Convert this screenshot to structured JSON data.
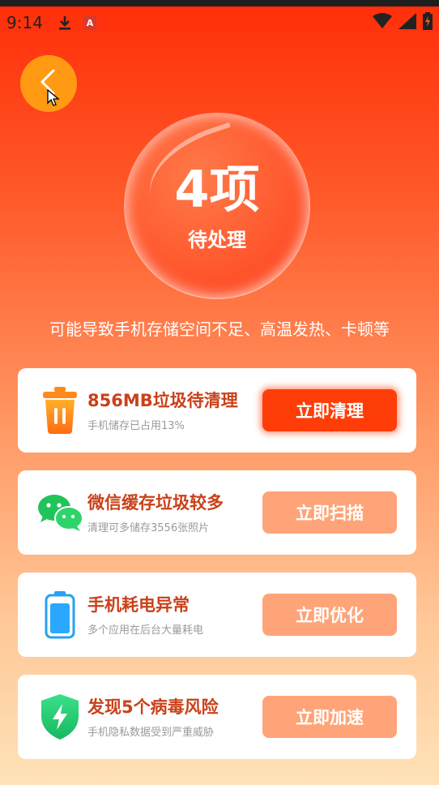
{
  "status_bar": {
    "time": "9:14",
    "icons": [
      "download-icon",
      "app-notification-icon",
      "wifi-icon",
      "signal-icon",
      "battery-icon"
    ]
  },
  "header": {
    "back_icon": "chevron-left-icon",
    "count": "4项",
    "count_label": "待处理",
    "subtitle": "可能导致手机存储空间不足、高温发热、卡顿等"
  },
  "items": [
    {
      "icon": "trash-icon",
      "title": "856MB垃圾待清理",
      "desc": "手机储存已占用13%",
      "button": "立即清理",
      "primary": true
    },
    {
      "icon": "wechat-icon",
      "title": "微信缓存垃圾较多",
      "desc": "清理可多储存3556张照片",
      "button": "立即扫描",
      "primary": false
    },
    {
      "icon": "battery-icon",
      "title": "手机耗电异常",
      "desc": "多个应用在后台大量耗电",
      "button": "立即优化",
      "primary": false
    },
    {
      "icon": "shield-bolt-icon",
      "title": "发现5个病毒风险",
      "desc": "手机隐私数据受到严重威胁",
      "button": "立即加速",
      "primary": false
    }
  ],
  "colors": {
    "accent": "#ff3d08",
    "title": "#c9411a",
    "secondary_button": "#ffa478",
    "back_button": "#ff9a12"
  }
}
